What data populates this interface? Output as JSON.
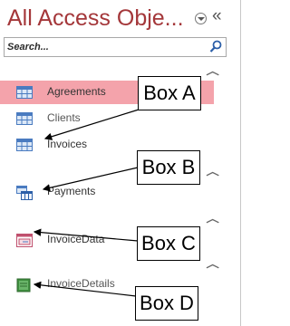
{
  "nav": {
    "title": "All Access Obje...",
    "search_placeholder": "Search...",
    "items": [
      {
        "label": "Agreements",
        "icon": "table-icon"
      },
      {
        "label": "Clients",
        "icon": "table-icon"
      },
      {
        "label": "Invoices",
        "icon": "table-icon"
      },
      {
        "label": "Payments",
        "icon": "query-icon"
      },
      {
        "label": "InvoiceData",
        "icon": "form-icon"
      },
      {
        "label": "InvoiceDetails",
        "icon": "report-icon"
      }
    ]
  },
  "callouts": [
    "Box A",
    "Box B",
    "Box C",
    "Box D"
  ],
  "colors": {
    "title": "#a4373a",
    "selected_row": "#f4a3ab",
    "table_icon": "#4a7bc0"
  }
}
